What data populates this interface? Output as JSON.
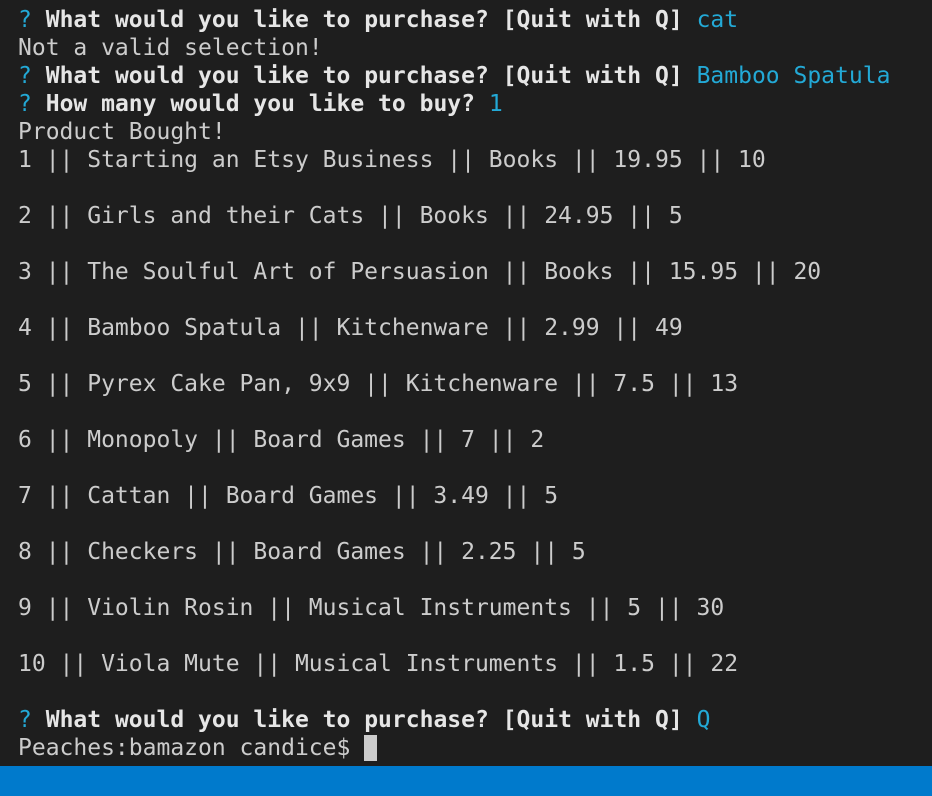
{
  "terminal": {
    "q1": {
      "mark": "?",
      "prompt": "What would you like to purchase? [Quit with Q]",
      "answer": "cat"
    },
    "invalid": "Not a valid selection!",
    "q2": {
      "mark": "?",
      "prompt": "What would you like to purchase? [Quit with Q]",
      "answer": "Bamboo Spatula"
    },
    "q3": {
      "mark": "?",
      "prompt": "How many would you like to buy?",
      "answer": "1"
    },
    "bought": "Product Bought!",
    "products": [
      "1 || Starting an Etsy Business || Books || 19.95 || 10",
      "2 || Girls and their Cats || Books || 24.95 || 5",
      "3 || The Soulful Art of Persuasion || Books || 15.95 || 20",
      "4 || Bamboo Spatula || Kitchenware || 2.99 || 49",
      "5 || Pyrex Cake Pan, 9x9 || Kitchenware || 7.5 || 13",
      "6 || Monopoly || Board Games || 7 || 2",
      "7 || Cattan || Board Games || 3.49 || 5",
      "8 || Checkers || Board Games || 2.25 || 5",
      "9 || Violin Rosin || Musical Instruments || 5 || 30",
      "10 || Viola Mute || Musical Instruments || 1.5 || 22"
    ],
    "q4": {
      "mark": "?",
      "prompt": "What would you like to purchase? [Quit with Q]",
      "answer": "Q"
    },
    "shell_prompt": "Peaches:bamazon candice$ "
  },
  "colors": {
    "background": "#1e1e1e",
    "text": "#cccccc",
    "accent": "#23a9d6",
    "statusbar": "#007acc"
  }
}
